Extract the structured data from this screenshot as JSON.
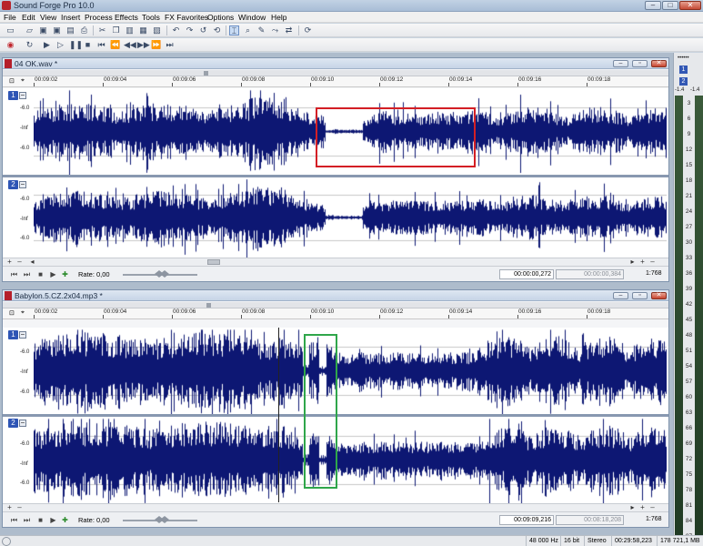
{
  "app": {
    "title": "Sound Forge Pro 10.0"
  },
  "menu": [
    "File",
    "Edit",
    "View",
    "Insert",
    "Process",
    "Effects",
    "Tools",
    "FX Favorites",
    "Options",
    "Window",
    "Help"
  ],
  "window1": {
    "filename": "04 OK.wav *",
    "ticks": [
      "00:09:02",
      "00:09:04",
      "00:09:06",
      "00:09:08",
      "00:09:10",
      "00:09:12",
      "00:09:14",
      "00:09:16",
      "00:09:18"
    ],
    "channels": [
      {
        "num": "1",
        "levels": [
          "-6.0",
          "-Inf",
          "-6.0"
        ]
      },
      {
        "num": "2",
        "levels": [
          "-6.0",
          "-Inf",
          "-6.0"
        ]
      }
    ],
    "transport": {
      "rate_label": "Rate: 0,00",
      "pos": "00:00:00,272",
      "length": "00:00:00,384",
      "zoom": "1:768"
    }
  },
  "window2": {
    "filename": "Babylon.5.CZ.2x04.mp3 *",
    "ticks": [
      "00:09:02",
      "00:09:04",
      "00:09:06",
      "00:09:08",
      "00:09:10",
      "00:09:12",
      "00:09:14",
      "00:09:16",
      "00:09:18"
    ],
    "channels": [
      {
        "num": "1",
        "levels": [
          "-6.0",
          "-Inf",
          "-6.0"
        ]
      },
      {
        "num": "2",
        "levels": [
          "-6.0",
          "-Inf",
          "-6.0"
        ]
      }
    ],
    "transport": {
      "rate_label": "Rate: 0,00",
      "pos": "00:09:09,216",
      "length": "00:08:18,208",
      "zoom": "1:768"
    }
  },
  "meters": {
    "top_dots": "••••••",
    "ch1": "1",
    "ch2": "2",
    "peak_l": "-1.4",
    "peak_r": "-1.4",
    "scale": [
      "3",
      "6",
      "9",
      "12",
      "15",
      "18",
      "21",
      "24",
      "27",
      "30",
      "33",
      "36",
      "39",
      "42",
      "45",
      "48",
      "51",
      "54",
      "57",
      "60",
      "63",
      "66",
      "69",
      "72",
      "75",
      "78",
      "81",
      "84",
      "87"
    ]
  },
  "status": {
    "rate": "48 000 Hz",
    "bits": "16 bit",
    "channels": "Stereo",
    "length": "00:29:58,223",
    "size": "178 721,1 MB"
  },
  "colors": {
    "waveform": "#0d1773",
    "background": "#ffffff",
    "highlight_red": "#d41f25",
    "highlight_green": "#2fa64a"
  }
}
